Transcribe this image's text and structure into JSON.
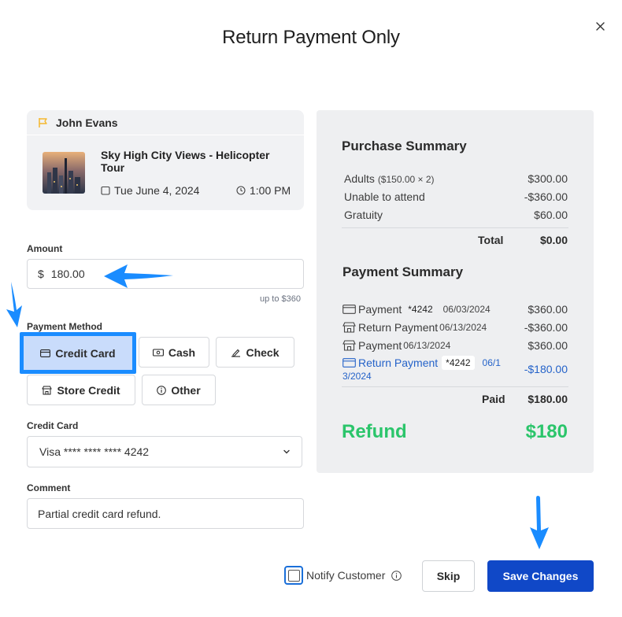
{
  "dialog": {
    "title": "Return Payment Only"
  },
  "booking": {
    "customer_name": "John Evans",
    "tour_name": "Sky High City Views - Helicopter Tour",
    "date": "Tue June 4, 2024",
    "time": "1:00 PM"
  },
  "form": {
    "amount_label": "Amount",
    "currency_symbol": "$",
    "amount_value": "180.00",
    "amount_hint": "up to $360",
    "payment_method_label": "Payment Method",
    "payment_methods": [
      {
        "label": "Credit Card",
        "icon": "credit-card-icon",
        "selected": true
      },
      {
        "label": "Cash",
        "icon": "cash-icon",
        "selected": false
      },
      {
        "label": "Check",
        "icon": "check-icon",
        "selected": false
      },
      {
        "label": "Store Credit",
        "icon": "store-icon",
        "selected": false
      },
      {
        "label": "Other",
        "icon": "info-icon",
        "selected": false
      }
    ],
    "credit_card_label": "Credit Card",
    "credit_card_value": "Visa **** **** **** 4242",
    "comment_label": "Comment",
    "comment_value": "Partial credit card refund."
  },
  "purchase_summary": {
    "title": "Purchase Summary",
    "rows": [
      {
        "label": "Adults",
        "detail": "($150.00 × 2)",
        "amount": "$300.00"
      },
      {
        "label": "Unable to attend",
        "detail": "",
        "amount": "-$360.00"
      },
      {
        "label": "Gratuity",
        "detail": "",
        "amount": "$60.00"
      }
    ],
    "total_label": "Total",
    "total_value": "$0.00"
  },
  "payment_summary": {
    "title": "Payment Summary",
    "rows": [
      {
        "label": "Payment",
        "card": "*4242",
        "date": "06/03/2024",
        "amount": "$360.00",
        "icon": "credit-card-icon"
      },
      {
        "label": "Return Payment",
        "card": "",
        "date": "06/13/2024",
        "amount": "-$360.00",
        "icon": "store-icon"
      },
      {
        "label": "Payment",
        "card": "",
        "date": "06/13/2024",
        "amount": "$360.00",
        "icon": "store-icon"
      },
      {
        "label": "Return Payment",
        "card": "*4242",
        "date_part1": "06/1",
        "date_part2": "3/2024",
        "amount": "-$180.00",
        "icon": "credit-card-icon"
      }
    ],
    "paid_label": "Paid",
    "paid_value": "$180.00",
    "refund_label": "Refund",
    "refund_value": "$180"
  },
  "footer": {
    "notify_label": "Notify Customer",
    "notify_checked": false,
    "skip_label": "Skip",
    "save_label": "Save Changes"
  },
  "colors": {
    "accent": "#1048c7",
    "highlight": "#1a8cff",
    "refund": "#2bc56b",
    "link": "#2563c9",
    "flag": "#f5b82e"
  }
}
